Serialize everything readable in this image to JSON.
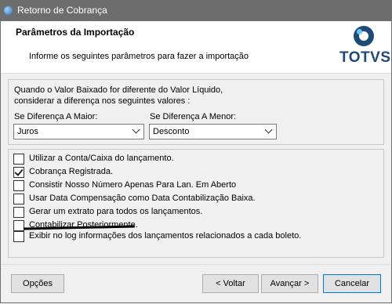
{
  "window": {
    "title": "Retorno de Cobrança"
  },
  "header": {
    "title": "Parâmetros da Importação",
    "subtitle": "Informe os seguintes parâmetros para fazer a importação",
    "logo_text": "TOTVS"
  },
  "valor_group": {
    "question_line1": "Quando o Valor Baixado for diferente do Valor Líquido,",
    "question_line2": "considerar a diferença nos seguintes valores :",
    "maior_label": "Se Diferença A Maior:",
    "maior_value": "Juros",
    "menor_label": "Se Diferença A Menor:",
    "menor_value": "Desconto"
  },
  "options": [
    {
      "label": "Utilizar a Conta/Caixa do lançamento.",
      "checked": false
    },
    {
      "label": "Cobrança Registrada.",
      "checked": true
    },
    {
      "label": "Consistir Nosso Número Apenas Para Lan. Em Aberto",
      "checked": false
    },
    {
      "label": "Usar Data Compensação como Data Contabilização Baixa.",
      "checked": false
    },
    {
      "label": "Gerar um extrato para todos os lançamentos.",
      "checked": false
    },
    {
      "label": "Contabilizar Posteriormente.",
      "checked": false
    },
    {
      "label": "Exibir no log informações dos lançamentos relacionados a cada boleto.",
      "checked": false
    }
  ],
  "buttons": {
    "options": "Opções",
    "back": "< Voltar",
    "next": "Avançar >",
    "cancel": "Cancelar"
  },
  "colors": {
    "titlebar": "#6d6d6d",
    "logo": "#1f4a78",
    "accent_border": "#0078d7"
  }
}
